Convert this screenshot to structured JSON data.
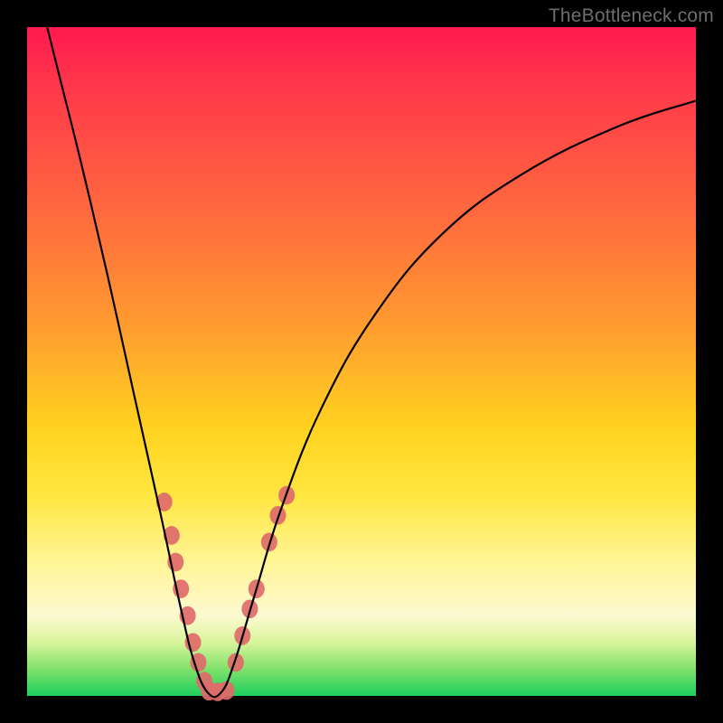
{
  "watermark": "TheBottleneck.com",
  "chart_data": {
    "type": "line",
    "title": "",
    "xlabel": "",
    "ylabel": "",
    "xlim": [
      0,
      100
    ],
    "ylim": [
      0,
      100
    ],
    "curve": {
      "name": "bottleneck-curve",
      "minimum_x": 27,
      "points": [
        {
          "x": 3,
          "y": 100
        },
        {
          "x": 5,
          "y": 92
        },
        {
          "x": 8,
          "y": 80
        },
        {
          "x": 12,
          "y": 63
        },
        {
          "x": 16,
          "y": 45
        },
        {
          "x": 20,
          "y": 27
        },
        {
          "x": 23,
          "y": 13
        },
        {
          "x": 25,
          "y": 5
        },
        {
          "x": 27,
          "y": 0.5
        },
        {
          "x": 29,
          "y": 0.5
        },
        {
          "x": 31,
          "y": 5
        },
        {
          "x": 34,
          "y": 15
        },
        {
          "x": 38,
          "y": 28
        },
        {
          "x": 44,
          "y": 43
        },
        {
          "x": 52,
          "y": 57
        },
        {
          "x": 62,
          "y": 69
        },
        {
          "x": 74,
          "y": 78
        },
        {
          "x": 88,
          "y": 85
        },
        {
          "x": 100,
          "y": 89
        }
      ]
    },
    "markers_left": [
      {
        "x": 20.5,
        "y": 29
      },
      {
        "x": 21.6,
        "y": 24
      },
      {
        "x": 22.2,
        "y": 20
      },
      {
        "x": 23.0,
        "y": 16
      },
      {
        "x": 24.0,
        "y": 12
      },
      {
        "x": 24.8,
        "y": 8
      },
      {
        "x": 25.6,
        "y": 5
      },
      {
        "x": 26.5,
        "y": 2.2
      }
    ],
    "markers_bottom": [
      {
        "x": 27.2,
        "y": 0.7
      },
      {
        "x": 28.5,
        "y": 0.6
      },
      {
        "x": 29.8,
        "y": 0.8
      }
    ],
    "markers_right": [
      {
        "x": 31.2,
        "y": 5
      },
      {
        "x": 32.2,
        "y": 9
      },
      {
        "x": 33.3,
        "y": 13
      },
      {
        "x": 34.3,
        "y": 16
      },
      {
        "x": 36.2,
        "y": 23
      },
      {
        "x": 37.5,
        "y": 27
      },
      {
        "x": 38.8,
        "y": 30
      }
    ],
    "marker_color": "#e06a6a",
    "marker_radius": 9
  }
}
